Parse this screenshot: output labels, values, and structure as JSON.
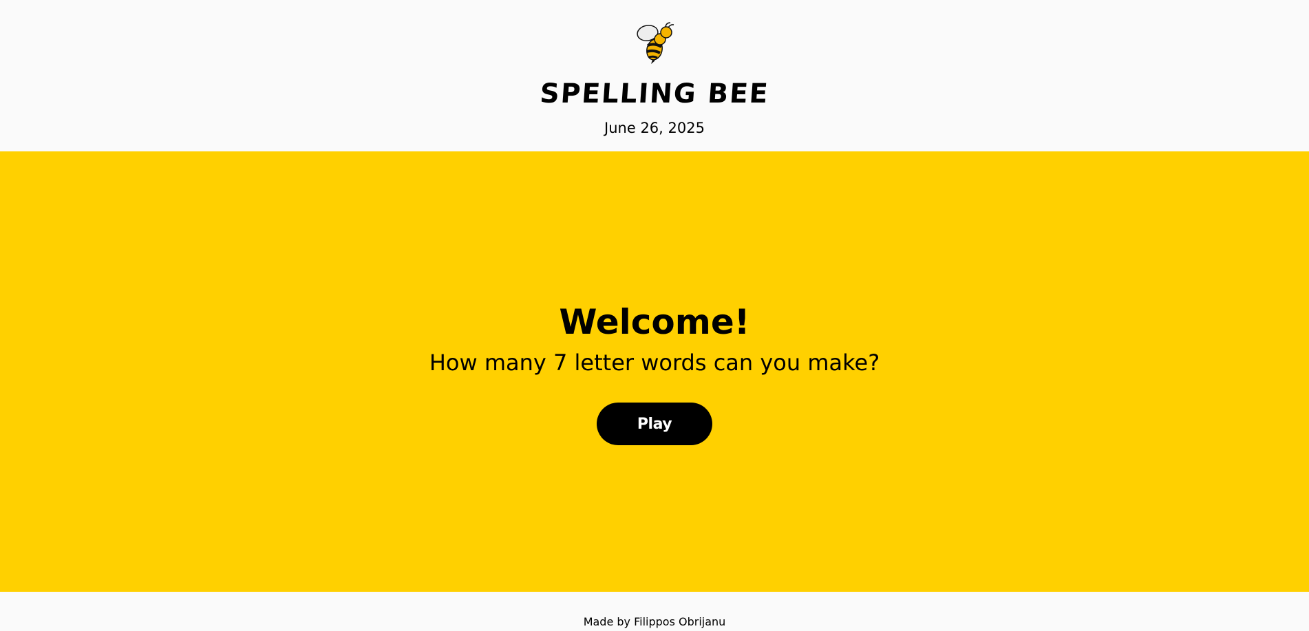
{
  "header": {
    "logo_icon": "bee-icon",
    "title": "SPELLING BEE",
    "date": "June 26, 2025"
  },
  "hero": {
    "background_color": "#ffd000",
    "welcome": "Welcome!",
    "subtitle": "How many 7 letter words can you make?",
    "play_label": "Play"
  },
  "footer": {
    "credit": "Made by Filippos Obrijanu"
  }
}
